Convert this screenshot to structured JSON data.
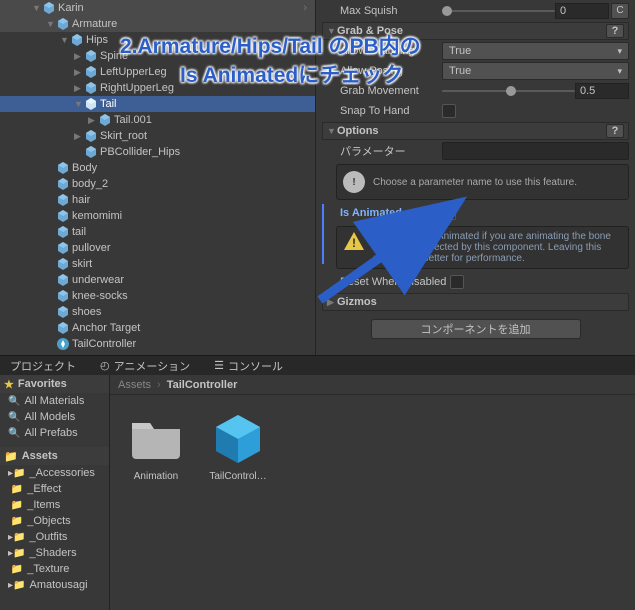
{
  "hierarchy": {
    "root": "Karin",
    "armature": "Armature",
    "hips": "Hips",
    "spine": "Spine",
    "leftUpperLeg": "LeftUpperLeg",
    "rightUpperLeg": "RightUpperLeg",
    "tail": "Tail",
    "tail001": "Tail.001",
    "skirtRoot": "Skirt_root",
    "pbcollider": "PBCollider_Hips",
    "body": "Body",
    "body2": "body_2",
    "hair": "hair",
    "kemomimi": "kemomimi",
    "tailObj": "tail",
    "pullover": "pullover",
    "skirt": "skirt",
    "underwear": "underwear",
    "kneeSocks": "knee-socks",
    "shoes": "shoes",
    "anchorTarget": "Anchor Target",
    "tailController": "TailController"
  },
  "inspector": {
    "maxSquish": "Max Squish",
    "maxSquishVal": "0",
    "letterC": "C",
    "grabPose": "Grab & Pose",
    "allowGrab": "Allow Grabbing",
    "allowGrabVal": "True",
    "allowPose": "Allow Posing",
    "allowPoseVal": "True",
    "grabMovement": "Grab Movement",
    "grabMovementVal": "0.5",
    "snapToHand": "Snap To Hand",
    "options": "Options",
    "parameter": "パラメーター",
    "infoText": "Choose a parameter name to use this feature.",
    "isAnimated": "Is Animated",
    "warnText": "Only enable IsAnimated if you are animating the bone transforms affected by this component. Leaving this disabled is better for performance.",
    "resetWhenDisabled": "Reset When Disabled",
    "gizmos": "Gizmos",
    "addComponent": "コンポーネントを追加",
    "questionMark": "?",
    "exclamation": "!"
  },
  "tabs": {
    "project": "プロジェクト",
    "animation": "アニメーション",
    "console": "コンソール"
  },
  "projectPanel": {
    "favorites": "Favorites",
    "allMaterials": "All Materials",
    "allModels": "All Models",
    "allPrefabs": "All Prefabs",
    "assets": "Assets",
    "accessories": "_Accessories",
    "effect": "_Effect",
    "items": "_Items",
    "objects": "_Objects",
    "outfits": "_Outfits",
    "shaders": "_Shaders",
    "texture": "_Texture",
    "amatousagi": "Amatousagi",
    "breadcrumbAssets": "Assets",
    "breadcrumbCurrent": "TailController",
    "assetAnimation": "Animation",
    "assetTailController": "TailControl…"
  },
  "annotation": {
    "line1": "2.Armature/Hips/Tail のPB内の",
    "line2": "Is Animatedにチェック"
  }
}
